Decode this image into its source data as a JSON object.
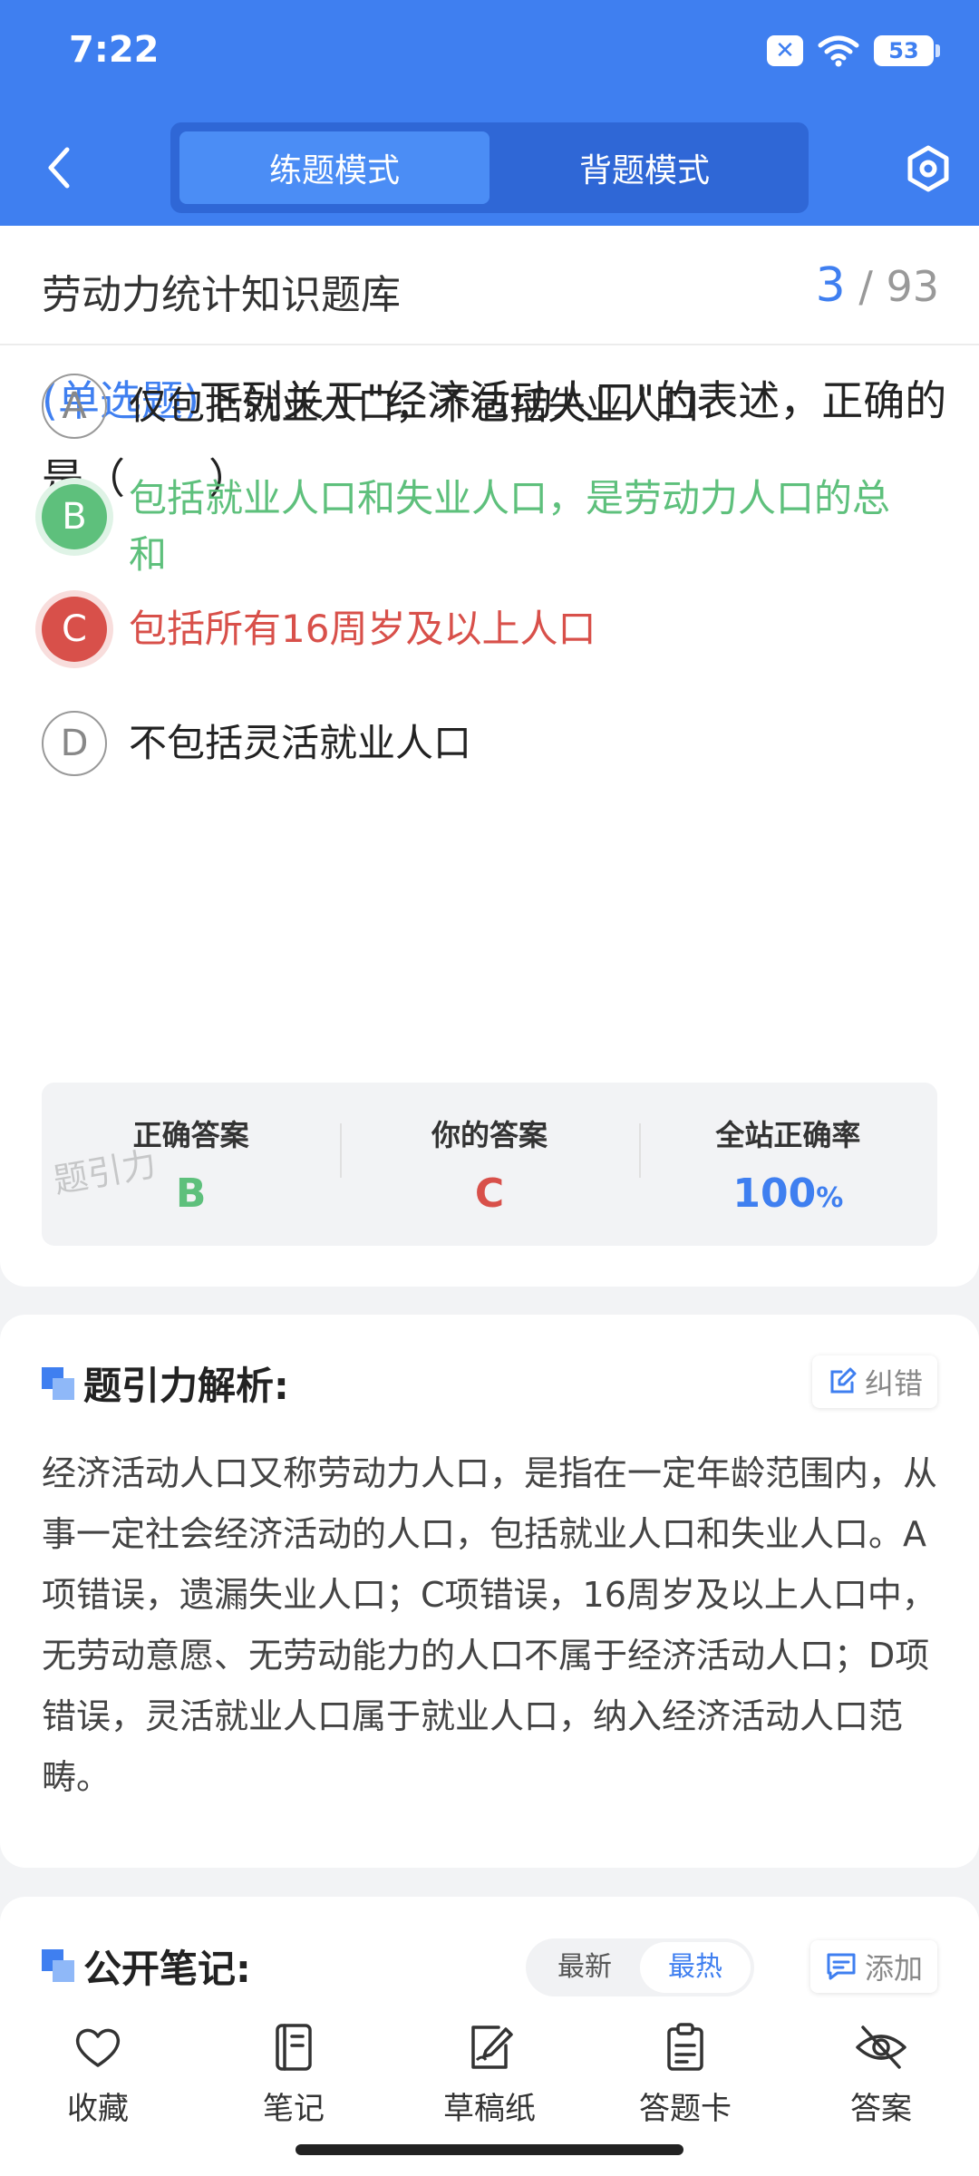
{
  "status_bar": {
    "time": "7:22",
    "battery": "53"
  },
  "header": {
    "tabs": [
      {
        "label": "练题模式",
        "active": true
      },
      {
        "label": "背题模式",
        "active": false
      }
    ],
    "accent_color": "#3f7ff0"
  },
  "bank": {
    "title": "劳动力统计知识题库",
    "current": "3",
    "total": "/ 93"
  },
  "question": {
    "type_label": "(单选题)",
    "text": "下列关于\"经济活动人口\"的表述，正确的是（　　）"
  },
  "options": [
    {
      "letter": "A",
      "text": "仅包括就业人口，不包括失业人口",
      "state": "normal"
    },
    {
      "letter": "B",
      "text": "包括就业人口和失业人口，是劳动力人口的总和",
      "state": "correct"
    },
    {
      "letter": "C",
      "text": "包括所有16周岁及以上人口",
      "state": "wrong"
    },
    {
      "letter": "D",
      "text": "不包括灵活就业人口",
      "state": "normal"
    }
  ],
  "answer": {
    "correct_label": "正确答案",
    "correct_value": "B",
    "yours_label": "你的答案",
    "yours_value": "C",
    "rate_label": "全站正确率",
    "rate_value": "100",
    "rate_unit": "%"
  },
  "watermark": "题引力",
  "analysis": {
    "title": "题引力解析:",
    "report_label": "纠错",
    "text": "经济活动人口又称劳动力人口，是指在一定年龄范围内，从事一定社会经济活动的人口，包括就业人口和失业人口。A项错误，遗漏失业人口；C项错误，16周岁及以上人口中，无劳动意愿、无劳动能力的人口不属于经济活动人口；D项错误，灵活就业人口属于就业人口，纳入经济活动人口范畴。"
  },
  "notes": {
    "title": "公开笔记:",
    "sort_latest": "最新",
    "sort_hot": "最热",
    "add_label": "添加"
  },
  "bottom_nav": [
    {
      "label": "收藏",
      "icon": "heart-icon"
    },
    {
      "label": "笔记",
      "icon": "notebook-icon"
    },
    {
      "label": "草稿纸",
      "icon": "draft-icon"
    },
    {
      "label": "答题卡",
      "icon": "answer-card-icon"
    },
    {
      "label": "答案",
      "icon": "eye-off-icon"
    }
  ]
}
